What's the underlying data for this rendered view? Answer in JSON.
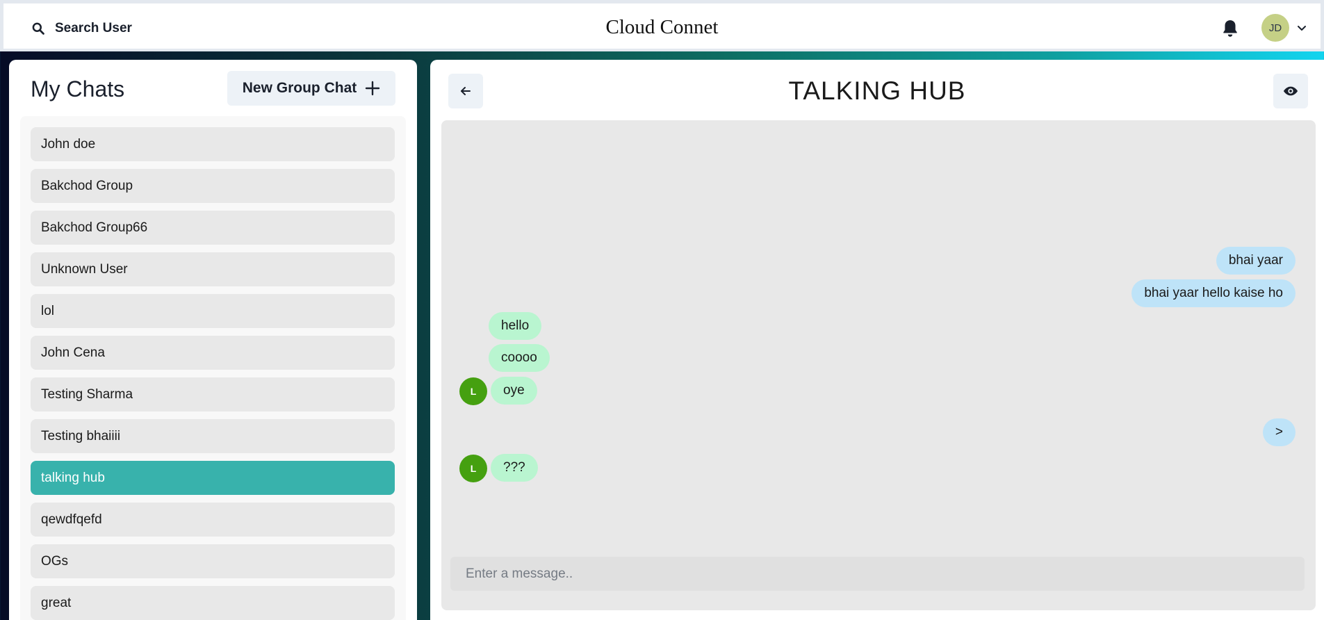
{
  "header": {
    "search_label": "Search User",
    "app_title": "Cloud Connet",
    "user_initials": "JD"
  },
  "sidebar": {
    "title": "My Chats",
    "new_group_label": "New Group Chat",
    "chats": [
      {
        "name": "John doe"
      },
      {
        "name": "Bakchod Group"
      },
      {
        "name": "Bakchod Group66"
      },
      {
        "name": "Unknown User"
      },
      {
        "name": "lol"
      },
      {
        "name": "John Cena"
      },
      {
        "name": "Testing Sharma"
      },
      {
        "name": "Testing bhaiiii"
      },
      {
        "name": "talking hub",
        "active": true
      },
      {
        "name": "qewdfqefd"
      },
      {
        "name": "OGs"
      },
      {
        "name": "great"
      }
    ]
  },
  "chat": {
    "title": "TALKING HUB",
    "messages": [
      {
        "text": "bhai yaar",
        "from": "me"
      },
      {
        "text": "bhai yaar hello kaise ho",
        "from": "me"
      },
      {
        "text": "hello",
        "from": "other"
      },
      {
        "text": "coooo",
        "from": "other"
      },
      {
        "text": "oye",
        "from": "other",
        "avatar": "L"
      },
      {
        "text": ">",
        "from": "me"
      },
      {
        "text": "???",
        "from": "other",
        "avatar": "L"
      }
    ],
    "input_placeholder": "Enter a message.."
  },
  "colors": {
    "active_chat": "#38b2ac",
    "sent_bubble": "#bee3f8",
    "received_bubble": "#b9f5d0",
    "sender_avatar": "#45a010",
    "user_avatar": "#c5d086"
  },
  "icons": {
    "search": "search-icon",
    "bell": "bell-icon",
    "chevron": "chevron-down-icon",
    "plus": "plus-icon",
    "back": "arrow-left-icon",
    "eye": "eye-icon"
  }
}
